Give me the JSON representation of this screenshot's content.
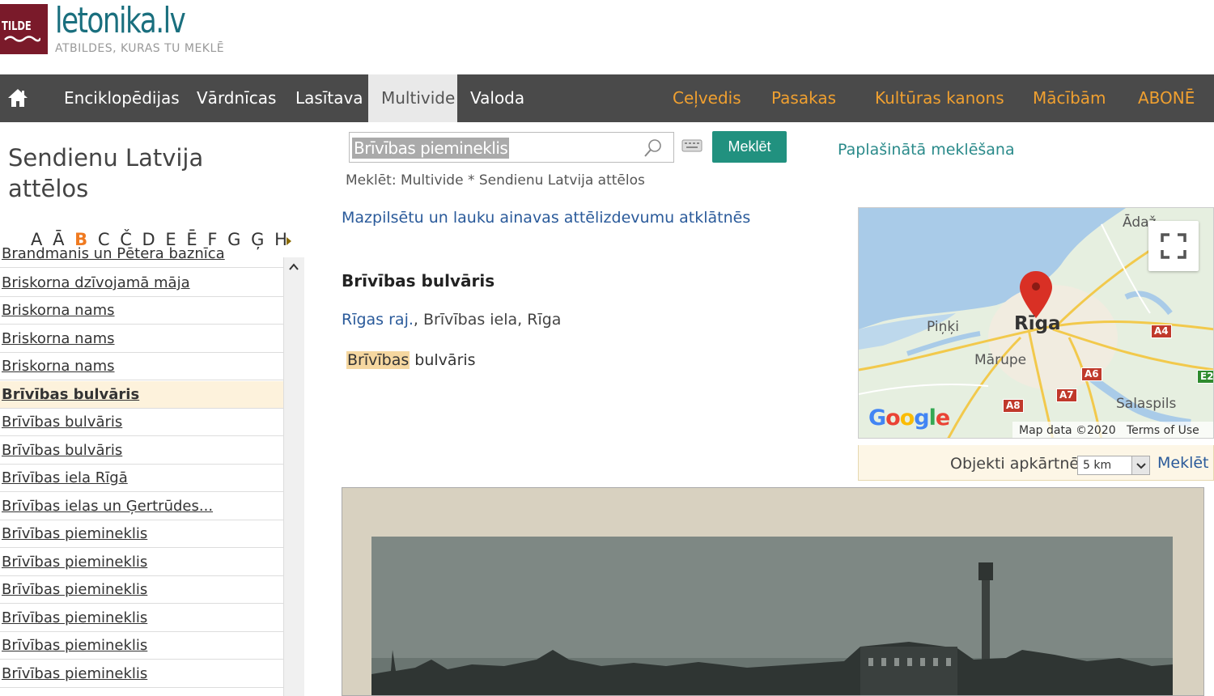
{
  "site": {
    "logo_text": "TILDE",
    "name": "letonika.lv",
    "tagline": "ATBILDES, KURAS TU MEKLĒ"
  },
  "nav": {
    "items": [
      "Enciklopēdijas",
      "Vārdnīcas",
      "Lasītava",
      "Multivide",
      "Valoda"
    ],
    "active": "Multivide",
    "right_items": [
      "Ceļvedis",
      "Pasakas",
      "Kultūras kanons",
      "Mācībām",
      "ABONĒ"
    ],
    "right_color": "#f0a030"
  },
  "sidebar": {
    "title": "Sendienu Latvija attēlos",
    "alphabet": [
      "A",
      "Ā",
      "B",
      "C",
      "Č",
      "D",
      "E",
      "Ē",
      "F",
      "G",
      "Ģ",
      "H"
    ],
    "selected_letter": "B",
    "items": [
      "Brandmanis un Pētera baznīca",
      "Briskorna dzīvojamā māja",
      "Briskorna nams",
      "Briskorna nams",
      "Briskorna nams",
      "Brīvības bulvāris",
      "Brīvības bulvāris",
      "Brīvības bulvāris",
      "Brīvības iela Rīgā",
      "Brīvības ielas un Ģertrūdes...",
      "Brīvības piemineklis",
      "Brīvības piemineklis",
      "Brīvības piemineklis",
      "Brīvības piemineklis",
      "Brīvības piemineklis",
      "Brīvības piemineklis"
    ],
    "current_index": 5
  },
  "search": {
    "value": "Brīvības piemineklis",
    "button": "Meklēt",
    "advanced": "Paplašinātā meklēšana",
    "scope": "Meklēt: Multivide * Sendienu Latvija attēlos"
  },
  "content": {
    "exhibit_link": "Mazpilsētu un lauku ainavas attēlizdevumu atklātnēs",
    "title": "Brīvības bulvāris",
    "location_link": "Rīgas raj.",
    "location_rest": ", Brīvības iela, Rīga",
    "caption_highlight": "Brīvības",
    "caption_rest": " bulvāris"
  },
  "map": {
    "city": "Rīga",
    "labels": {
      "pinki": "Piņķi",
      "marupe": "Mārupe",
      "salaspils": "Salaspils",
      "adazi": "Ādaž"
    },
    "roads": [
      "A4",
      "A6",
      "A7",
      "A8",
      "E2"
    ],
    "google": "Google",
    "data_text": "Map data ©2020",
    "terms": "Terms of Use"
  },
  "nearby": {
    "label": "Objekti apkārtnē",
    "distance": "5 km",
    "button": "Meklēt"
  }
}
